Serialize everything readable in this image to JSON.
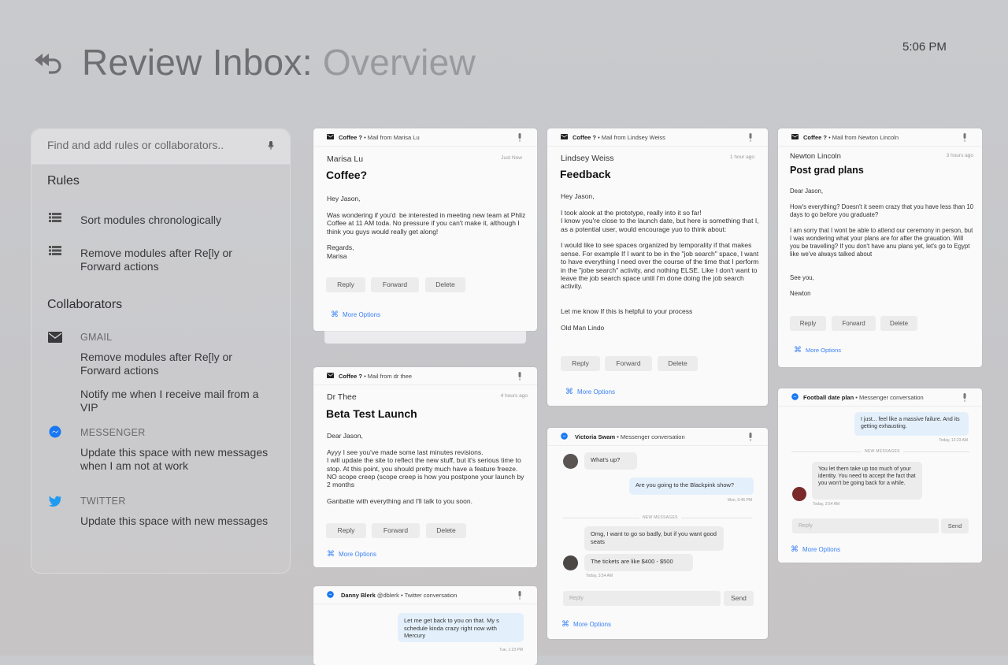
{
  "header": {
    "title_main": "Review Inbox:",
    "title_sub": "Overview",
    "time": "5:06 PM"
  },
  "left_panel": {
    "search_placeholder": "Find and add rules or collaborators..",
    "rules_title": "Rules",
    "rules": [
      {
        "label": "Sort modules chronologically"
      },
      {
        "label": "Remove modules after Re[ly or Forward actions"
      }
    ],
    "collaborators_title": "Collaborators",
    "collaborators": [
      {
        "source": "GMAIL",
        "icon": "mail-icon",
        "rules": [
          "Remove modules after Re[ly or Forward actions",
          "Notify me when I receive mail from a VIP"
        ]
      },
      {
        "source": "MESSENGER",
        "icon": "messenger-icon",
        "rules": [
          "Update this space with new messages when I am not at work"
        ]
      },
      {
        "source": "TWITTER",
        "icon": "twitter-icon",
        "rules": [
          "Update this space with new messages"
        ]
      }
    ]
  },
  "cards": {
    "marisa": {
      "header_bold": "Coffee ?",
      "header_rest": " • Mail from Marisa Lu",
      "sender": "Marisa Lu",
      "time": "Just Now",
      "subject": "Coffee?",
      "body": "Hey Jason,\n\nWas wondering if you'd  be interested in meeting new team at Phliz Coffee at 11 AM toda. No pressure if you can't make it, although I think you guys would really get along!\n\nRegards,\nMarisa",
      "reply": "Reply",
      "forward": "Forward",
      "delete": "Delete",
      "more": "More Options"
    },
    "drthee": {
      "header_bold": "Coffee ?",
      "header_rest": " • Mail from dr thee",
      "sender": "Dr Thee",
      "time": "4 hours ago",
      "subject": "Beta Test Launch",
      "body": "Dear Jason,\n\nAyyy I see you've made some last minutes revisions.\nI will update the site to reflect the new stuff, but it's serious time to stop. At this point, you should pretty much have a feature freeze. NO scope creep (scope creep is how you postpone your launch by 2 months\n\nGanbatte with everything and I'll talk to you soon.",
      "reply": "Reply",
      "forward": "Forward",
      "delete": "Delete",
      "more": "More Options"
    },
    "danny": {
      "header_bold": "Danny Blerk",
      "header_rest": " @dblerk • Twitter conversation",
      "message": "Let me get back to you on that. My s schedule kinda crazy right now with Mercury",
      "time": "Tue, 1:23 PM"
    },
    "lindsey": {
      "header_bold": "Coffee ?",
      "header_rest": " • Mail from Lindsey Weiss",
      "sender": "Lindsey Weiss",
      "time": "1 hour ago",
      "subject": "Feedback",
      "body": "Hey Jason,\n\nI took alook at the prototype, really into it so far!\nI know you're close to the launch date, but here is something that I, as a potential user, would encourage yuo to think about:\n\nI would like to see spaces organized by temporality if that makes sense. For example If I want to be in the \"job search\" space, I want to have everything I need over the course of the time that I perform in the \"jobe search\" activity, and nothing ELSE. Like I don't want to leave the job search space until I'm done doing the job search activity.\n\n\nLet me know If this is helpful to your process\n\nOld Man Lindo",
      "reply": "Reply",
      "forward": "Forward",
      "delete": "Delete",
      "more": "More Options"
    },
    "victoria": {
      "header_bold": "Victoria Swam",
      "header_rest": " • Messenger conversation",
      "msg1": "What's up?",
      "msg2": "Are you going to the Blackpink show?",
      "msg2_time": "Mon, 6:45 PM",
      "new_label": "NEW MESSAGES",
      "msg3": "Omg, I want to go so badly, but if you want good seats",
      "msg4": "The tickets are like $400 - $500",
      "msg4_time": "Today, 3:54 AM",
      "reply_placeholder": "Reply",
      "send": "Send",
      "more": "More Options"
    },
    "newton": {
      "header_bold": "Coffee ?",
      "header_rest": " • Mail from Newton Lincoln",
      "sender": "Newton Lincoln",
      "time": "3 hours ago",
      "subject": "Post grad plans",
      "body": "Dear Jason,\n\nHow's everything? Doesn't it seem crazy that you have less than 10 days to go before you graduate?\n\nI am sorry that I wont be able to attend our ceremony in person, but I was wondering what your plans are for after the grauation. Will you be travelling? If you don't have anu plans yet, let's go to Egypt like we've always talked about\n\n\nSee you,\n\nNewton",
      "reply": "Reply",
      "forward": "Forward",
      "delete": "Delete",
      "more": "More Options"
    },
    "football": {
      "header_bold": "Football date plan",
      "header_rest": " • Messenger conversation",
      "msg1": "I just... feel like a massive failure. And its getting exhausting.",
      "msg1_time": "Today, 12:23 AM",
      "new_label": "NEW MESSAGES",
      "msg2": "You let them take up too much of your identity. You need to accept the fact that you won't be going back for a while.",
      "msg2_time": "Today, 3:54 AM",
      "reply_placeholder": "Reply",
      "send": "Send",
      "more": "More Options"
    }
  }
}
